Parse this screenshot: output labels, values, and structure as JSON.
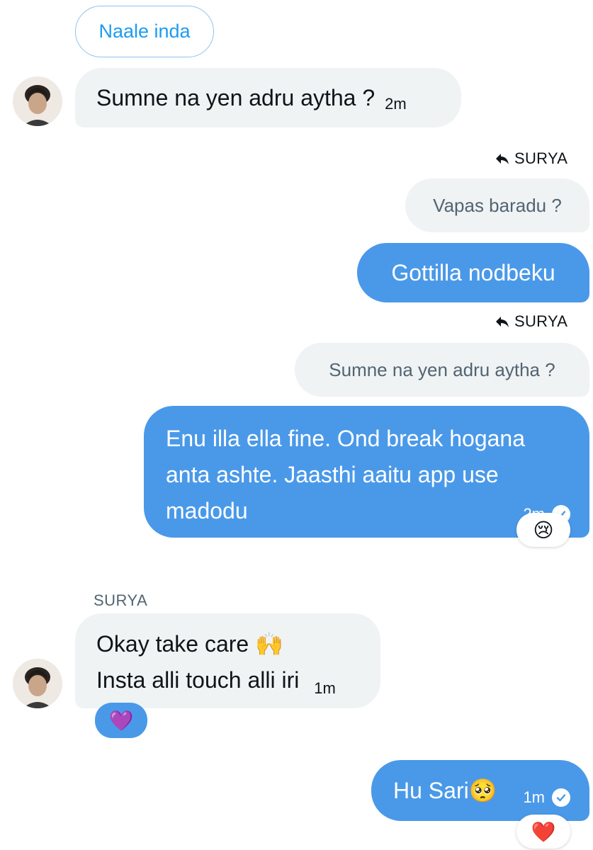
{
  "quick_reply": {
    "label": "Naale inda"
  },
  "messages": {
    "m1": {
      "text": "Sumne na yen adru aytha ?",
      "time": "2m"
    },
    "m2": {
      "reply_to": "SURYA",
      "quote": "Vapas baradu ?",
      "text": "Gottilla nodbeku"
    },
    "m3": {
      "reply_to": "SURYA",
      "quote": "Sumne na yen adru aytha ?",
      "lines": [
        "Enu illa ella fine. Ond break hogana",
        "anta ashte. Jaasthi aaitu app use",
        "madodu"
      ],
      "time": "2m",
      "reaction": "😢"
    },
    "m4": {
      "sender": "SURYA",
      "line1": "Okay take care 🙌",
      "line2": "Insta alli touch alli iri",
      "time": "1m",
      "reaction": "💜"
    },
    "m5": {
      "text": "Hu Sari🥺",
      "time": "1m",
      "reaction": "❤️"
    }
  },
  "colors": {
    "outgoing_bubble": "#4a99e9",
    "incoming_bubble": "#eff3f4",
    "accent": "#1d9bf0"
  },
  "icons": {
    "reply": "reply-arrow-icon",
    "read": "check-circle-icon"
  }
}
